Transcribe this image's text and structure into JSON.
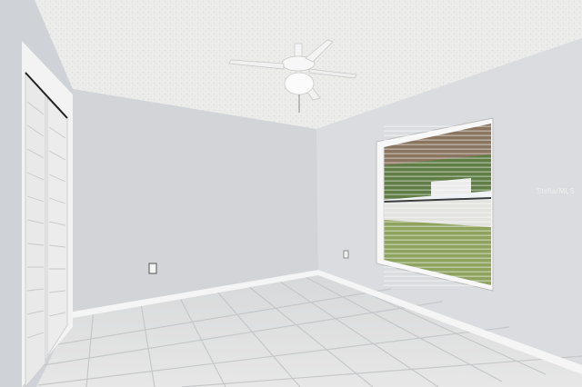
{
  "scene": {
    "subject": "empty-bedroom",
    "colors": {
      "ceiling": "#ececea",
      "left_wall": "#cdd0d4",
      "back_wall": "#d4d6da",
      "right_wall": "#dcdee1",
      "floor_tile": "#dedfe0",
      "grout": "#c8c9cb",
      "baseboard": "#f4f4f4",
      "closet_door": "#f2f2f2",
      "fan": "#f5f5f5",
      "window_frame": "#f6f6f6",
      "blind": "#8a7560",
      "lawn": "#8ea35e",
      "trees": "#5f7d45",
      "fence": "#e3e3e0",
      "sky": "#eef2f6"
    },
    "objects": [
      "ceiling-fan",
      "bifold-closet-door",
      "window-with-blinds",
      "electrical-outlet",
      "tile-floor",
      "baseboard"
    ]
  },
  "watermark": {
    "text": "StellarMLS"
  }
}
